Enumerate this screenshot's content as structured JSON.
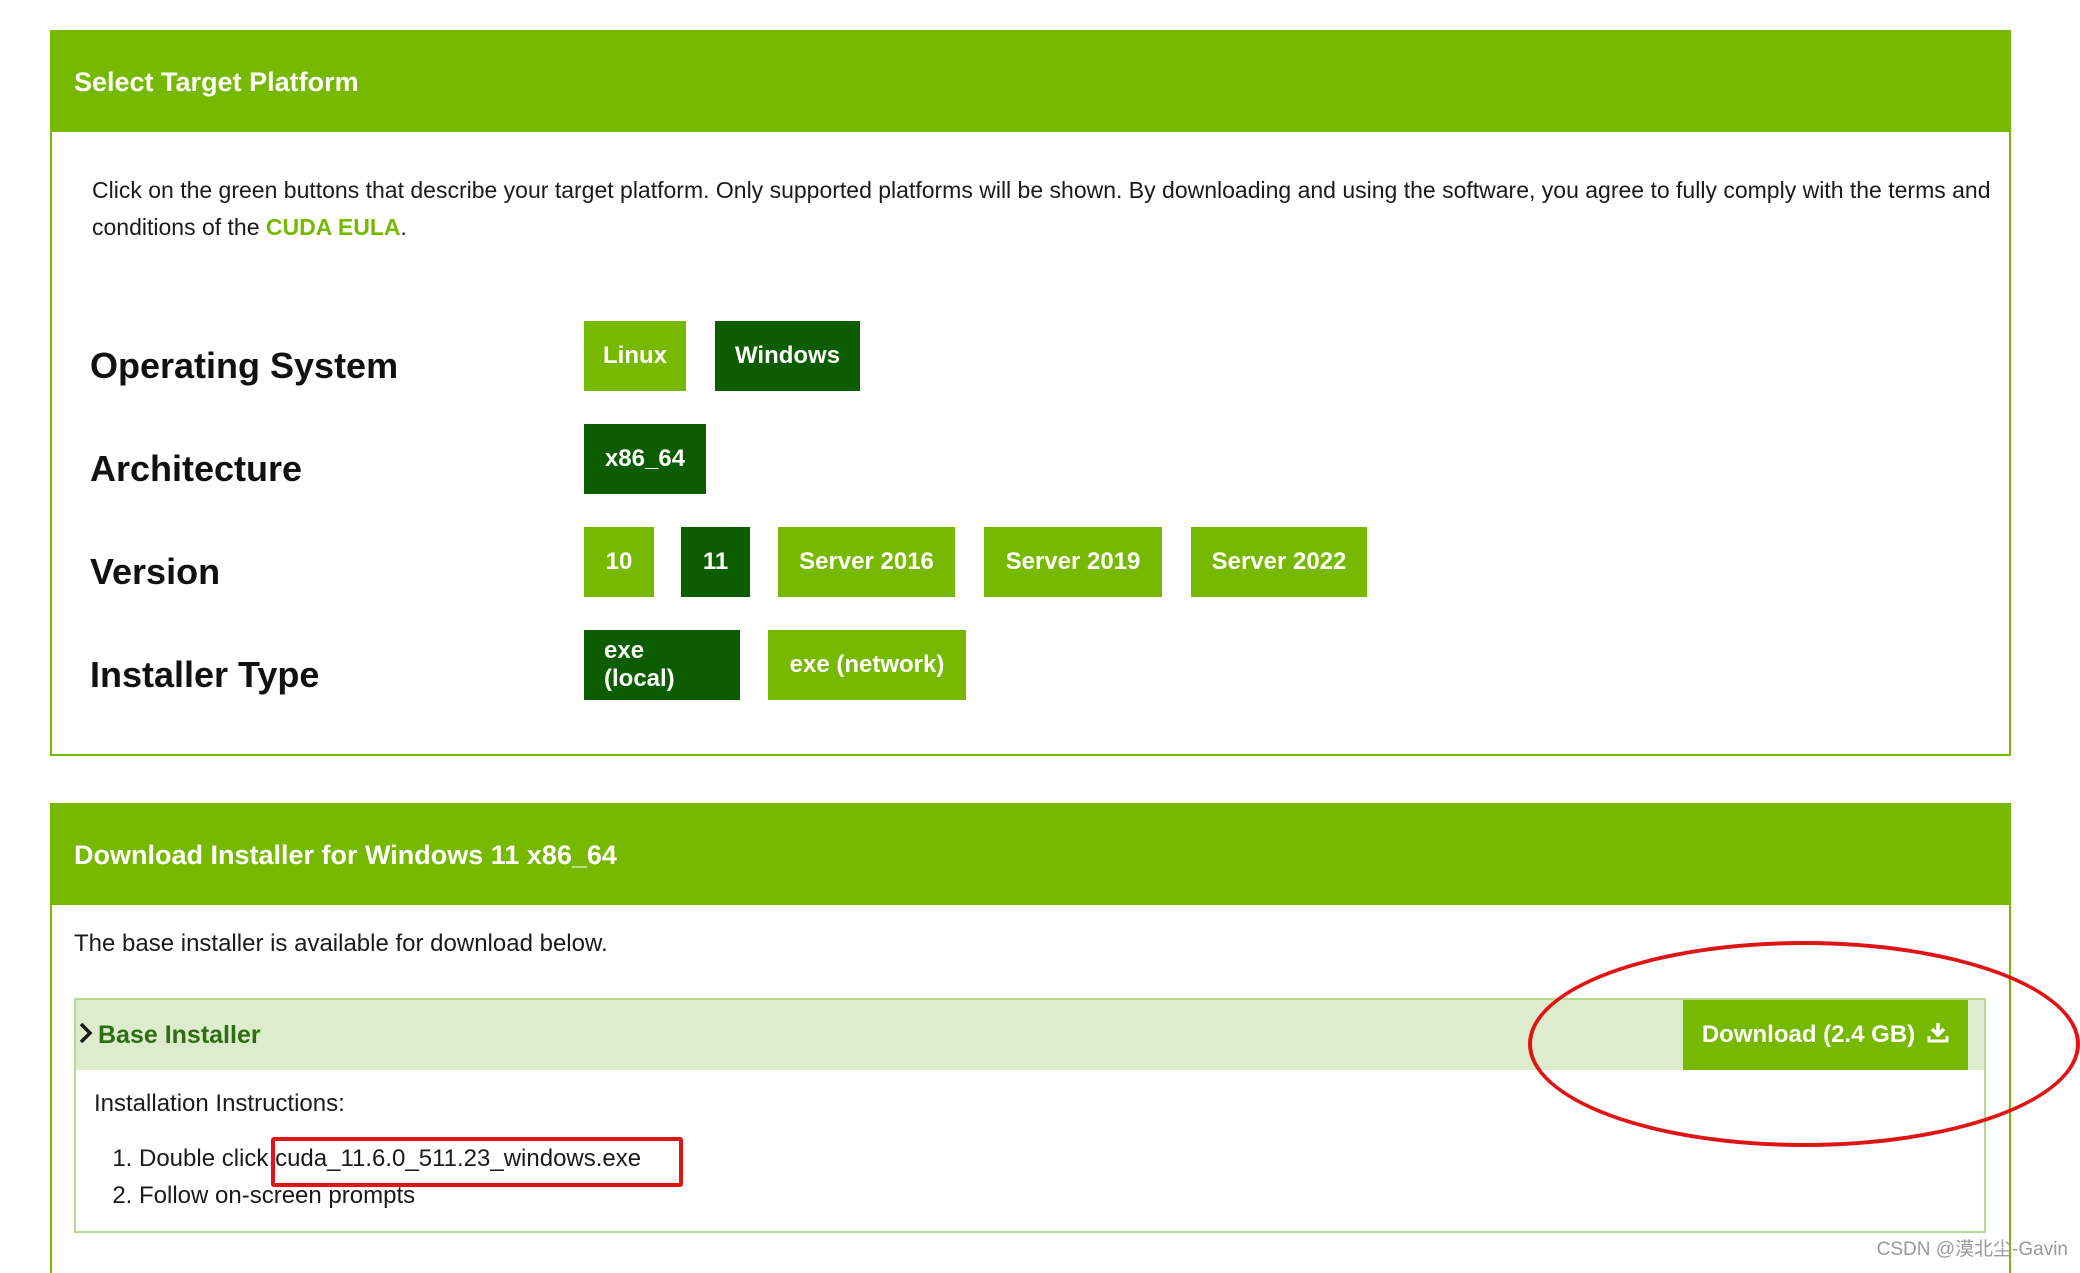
{
  "platform": {
    "header": "Select Target Platform",
    "intro_text": "Click on the green buttons that describe your target platform. Only supported platforms will be shown. By downloading and using the software, you agree to fully comply with the terms and conditions of the ",
    "eula_link": "CUDA EULA",
    "intro_end": ".",
    "rows": {
      "os": {
        "label": "Operating System",
        "options": [
          "Linux",
          "Windows"
        ],
        "selected": "Windows"
      },
      "arch": {
        "label": "Architecture",
        "options": [
          "x86_64"
        ],
        "selected": "x86_64"
      },
      "version": {
        "label": "Version",
        "options": [
          "10",
          "11",
          "Server 2016",
          "Server 2019",
          "Server 2022"
        ],
        "selected": "11"
      },
      "installer": {
        "label": "Installer Type",
        "options": [
          "exe (local)",
          "exe (network)"
        ],
        "selected": "exe (local)"
      }
    }
  },
  "download": {
    "header": "Download Installer for Windows 11 x86_64",
    "description": "The base installer is available for download below.",
    "base_installer": {
      "title": "Base Installer",
      "download_label": "Download (2.4 GB)",
      "instructions_label": "Installation Instructions:",
      "step1_prefix": "Double click ",
      "step1_file": "cuda_11.6.0_511.23_windows.exe",
      "step2": "Follow on-screen prompts"
    }
  },
  "watermark": "CSDN @漠北尘-Gavin",
  "colors": {
    "nvidia_green": "#76b900",
    "selected_green": "#0c5c00",
    "annotation_red": "#e01414"
  }
}
